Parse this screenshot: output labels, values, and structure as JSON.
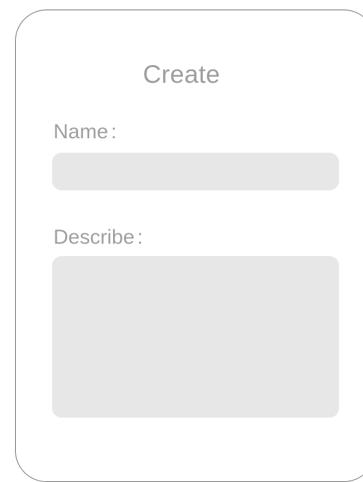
{
  "form": {
    "title": "Create",
    "name_label": "Name",
    "name_value": "",
    "describe_label": "Describe",
    "describe_value": "",
    "colon": ":"
  },
  "colors": {
    "border": "#6a6a6a",
    "text": "#a0a0a0",
    "field_bg": "#e7e7e7"
  }
}
